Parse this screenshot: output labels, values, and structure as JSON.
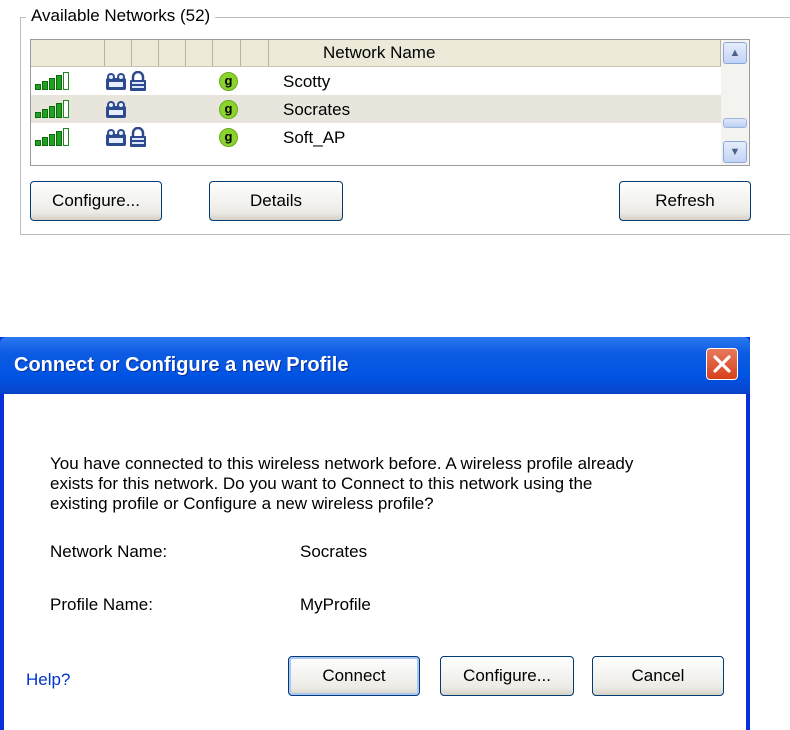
{
  "networks_panel": {
    "title": "Available Networks (52)",
    "column_header": "Network Name",
    "rows": [
      {
        "name": "Scotty",
        "signal_bars": 4,
        "secured": true,
        "standard": "g"
      },
      {
        "name": "Socrates",
        "signal_bars": 4,
        "secured": false,
        "standard": "g"
      },
      {
        "name": "Soft_AP",
        "signal_bars": 4,
        "secured": true,
        "standard": "g"
      }
    ],
    "selected_row": 1,
    "buttons": {
      "configure": "Configure...",
      "details": "Details",
      "refresh": "Refresh"
    }
  },
  "dialog": {
    "title": "Connect or Configure a new Profile",
    "message_lines": [
      "You have connected to this wireless network before. A wireless profile already",
      "exists for this network. Do you want to Connect to this network using the",
      "existing profile or Configure a new wireless profile?"
    ],
    "network_name_label": "Network Name:",
    "network_name_value": "Socrates",
    "profile_name_label": "Profile Name:",
    "profile_name_value": "MyProfile",
    "help_link": "Help?",
    "buttons": {
      "connect": "Connect",
      "configure": "Configure...",
      "cancel": "Cancel"
    }
  },
  "colors": {
    "title_bar": "#0054e3",
    "signal_green": "#21a121",
    "g_badge": "#8bd32d",
    "close_button": "#d6401c",
    "help_link": "#0033cc"
  },
  "icons": [
    "signal-strength-icon",
    "peer-network-icon",
    "lock-icon",
    "g-standard-icon",
    "close-icon",
    "scroll-up-icon",
    "scroll-down-icon"
  ]
}
